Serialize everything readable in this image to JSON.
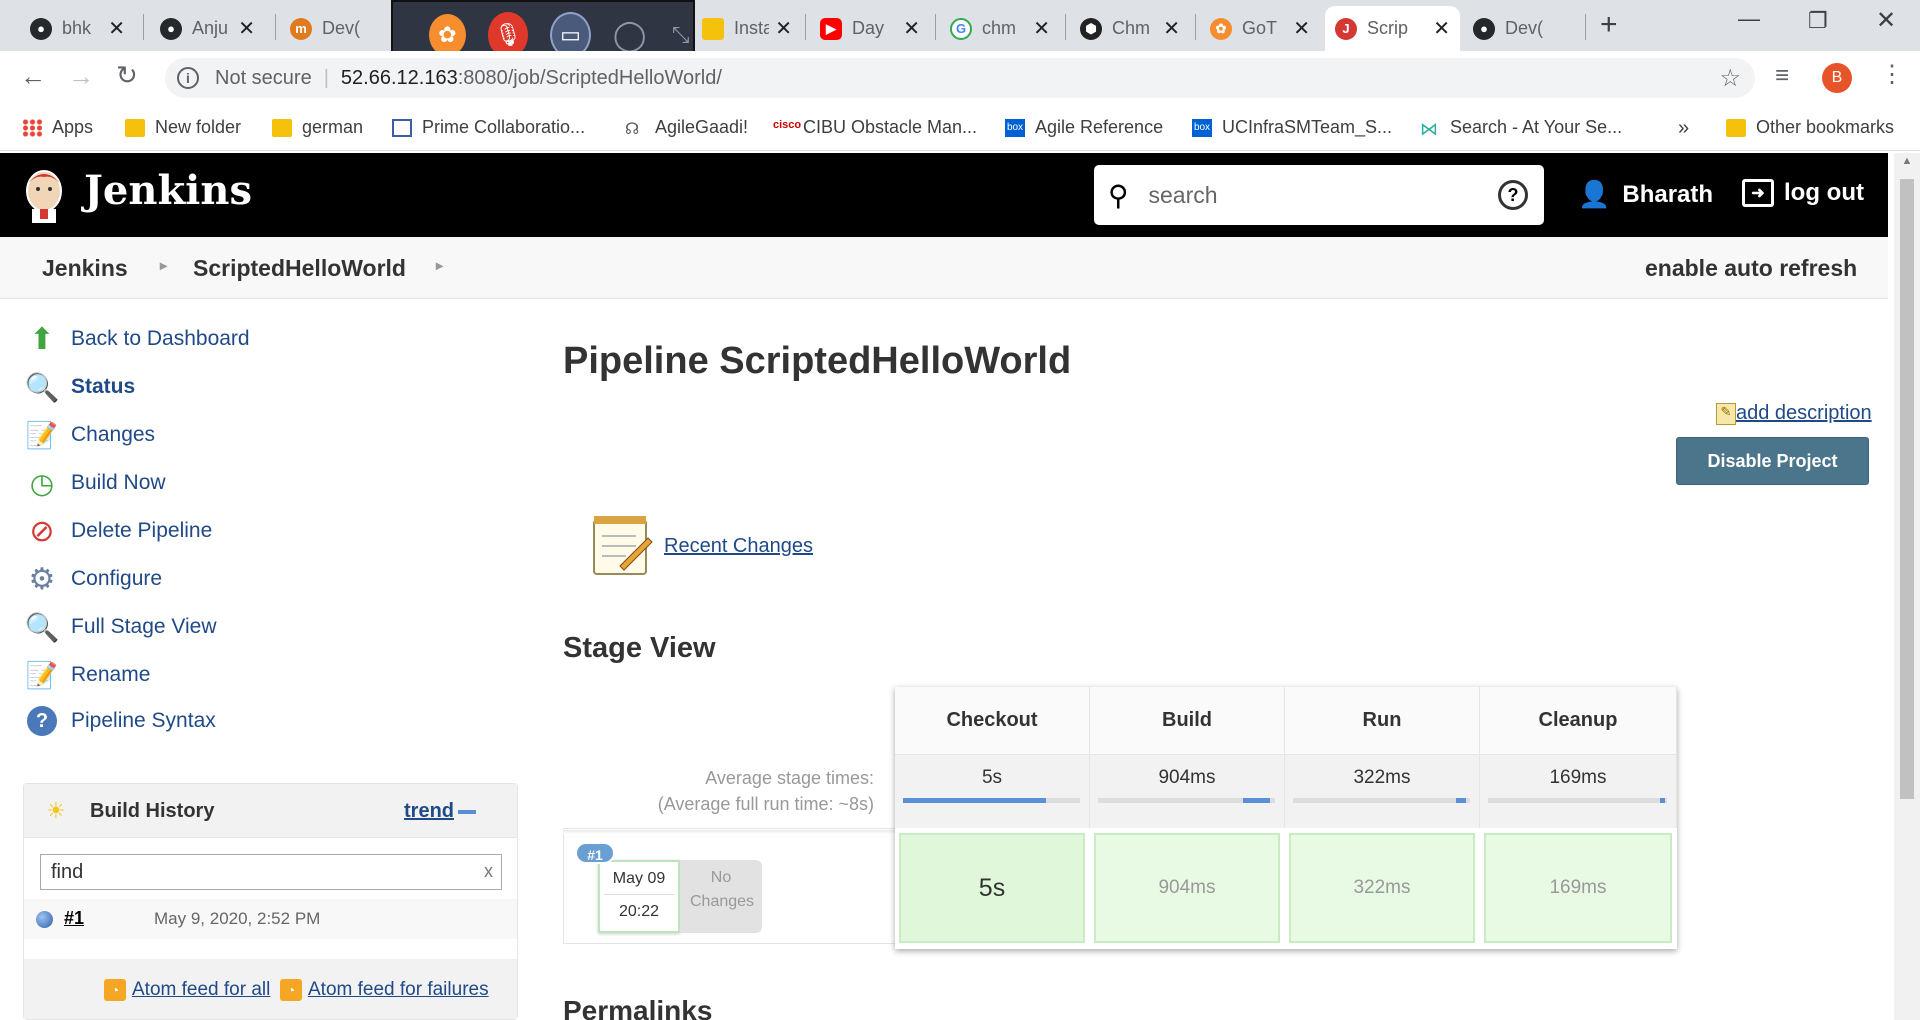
{
  "browser": {
    "tabs": [
      {
        "title": "bhk",
        "icon": "github-icon"
      },
      {
        "title": "Anju",
        "icon": "github-icon"
      },
      {
        "title": "Dev(",
        "icon": "mail-icon"
      },
      {
        "title": "Insta",
        "icon": "folder-icon"
      },
      {
        "title": "Day",
        "icon": "youtube-icon"
      },
      {
        "title": "chm",
        "icon": "google-icon"
      },
      {
        "title": "Chm",
        "icon": "hexagon-icon"
      },
      {
        "title": "GoT",
        "icon": "gotomeeting-icon"
      },
      {
        "title": "Scrip",
        "icon": "jenkins-icon"
      },
      {
        "title": "Dev(",
        "icon": "github-icon"
      }
    ],
    "security": "Not secure",
    "url_host": "52.66.12.163",
    "url_rest": ":8080/job/ScriptedHelloWorld/",
    "profile_initial": "B",
    "bookmarks": [
      "Apps",
      "New folder",
      "german",
      "Prime Collaboratio...",
      "AgileGaadi!",
      "CIBU Obstacle Man...",
      "Agile Reference",
      "UCInfraSMTeam_S...",
      "Search - At Your Se..."
    ],
    "bookmarks_overflow": "»",
    "other_bookmarks": "Other bookmarks"
  },
  "jenkins": {
    "logo_text": "Jenkins",
    "search_placeholder": "search",
    "user": "Bharath",
    "logout": "log out",
    "breadcrumb": [
      "Jenkins",
      "ScriptedHelloWorld"
    ],
    "auto_refresh": "enable auto refresh",
    "sidebar": [
      {
        "label": "Back to Dashboard",
        "icon": "up-arrow-icon"
      },
      {
        "label": "Status",
        "icon": "magnifier-icon"
      },
      {
        "label": "Changes",
        "icon": "notepad-icon"
      },
      {
        "label": "Build Now",
        "icon": "clock-play-icon"
      },
      {
        "label": "Delete Pipeline",
        "icon": "no-entry-icon"
      },
      {
        "label": "Configure",
        "icon": "gear-icon"
      },
      {
        "label": "Full Stage View",
        "icon": "magnifier-icon"
      },
      {
        "label": "Rename",
        "icon": "notepad-icon"
      },
      {
        "label": "Pipeline Syntax",
        "icon": "help-icon"
      }
    ],
    "build_history": {
      "title": "Build History",
      "trend": "trend",
      "find_placeholder": "find",
      "builds": [
        {
          "number": "#1",
          "date": "May 9, 2020, 2:52 PM"
        }
      ],
      "feed_all": "Atom feed for all",
      "feed_failures": "Atom feed for failures"
    },
    "page_title": "Pipeline ScriptedHelloWorld",
    "add_description": "add description",
    "disable_project": "Disable Project",
    "recent_changes": "Recent Changes",
    "stage_view_title": "Stage View",
    "stages": [
      "Checkout",
      "Build",
      "Run",
      "Cleanup"
    ],
    "avg_label": "Average stage times:",
    "avg_full": "(Average full run time: ~8s)",
    "avg_times": [
      "5s",
      "904ms",
      "322ms",
      "169ms"
    ],
    "run": {
      "badge": "#1",
      "date": "May 09",
      "time": "20:22",
      "changes": "No Changes",
      "durations": [
        "5s",
        "904ms",
        "322ms",
        "169ms"
      ]
    },
    "permalinks": "Permalinks"
  }
}
